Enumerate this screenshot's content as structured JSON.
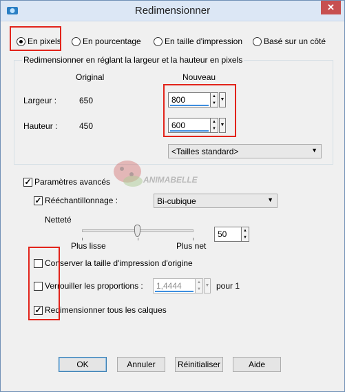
{
  "window": {
    "title": "Redimensionner",
    "close_symbol": "✕"
  },
  "mode": {
    "options": [
      {
        "label": "En pixels",
        "selected": true
      },
      {
        "label": "En pourcentage",
        "selected": false
      },
      {
        "label": "En taille d'impression",
        "selected": false
      },
      {
        "label": "Basé sur un côté",
        "selected": false
      }
    ]
  },
  "dimensions": {
    "group_title": "Redimensionner en réglant la largeur et la hauteur en pixels",
    "col_original": "Original",
    "col_new": "Nouveau",
    "width_label": "Largeur :",
    "width_original": "650",
    "width_new": "800",
    "height_label": "Hauteur :",
    "height_original": "450",
    "height_new": "600",
    "standard_sizes": "<Tailles standard>"
  },
  "advanced": {
    "advanced_label": "Paramètres avancés",
    "advanced_checked": true,
    "resample_label": "Rééchantillonnage :",
    "resample_checked": true,
    "resample_value": "Bi-cubique",
    "sharpness_label": "Netteté",
    "sharpness_value": "50",
    "sharpness_min_label": "Plus lisse",
    "sharpness_max_label": "Plus net",
    "sharpness_level": 0.5,
    "keep_print_size_label": "Conserver la taille d'impression d'origine",
    "keep_print_size_checked": false,
    "lock_ratio_label": "Verrouiller les proportions :",
    "lock_ratio_checked": false,
    "ratio_value": "1,4444",
    "ratio_suffix": "pour 1",
    "resize_all_layers_label": "Redimensionner tous les calques",
    "resize_all_layers_checked": true
  },
  "watermark": "ANIMABELLE",
  "buttons": {
    "ok": "OK",
    "cancel": "Annuler",
    "reset": "Réinitialiser",
    "help": "Aide"
  },
  "colors": {
    "highlight": "#e2231a",
    "accent": "#3d8ee0"
  }
}
